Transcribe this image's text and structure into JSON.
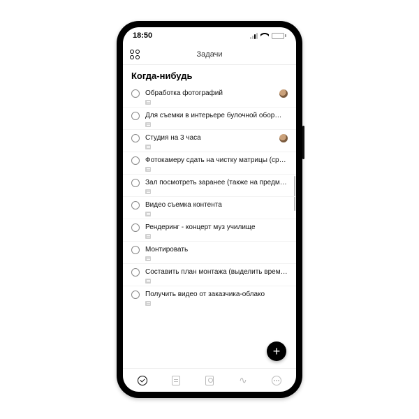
{
  "statusbar": {
    "time": "18:50"
  },
  "header": {
    "title": "Задачи"
  },
  "section": {
    "title": "Когда-нибудь"
  },
  "tasks": [
    {
      "title": "Обработка фотографий",
      "has_note": true,
      "has_avatar": true
    },
    {
      "title": "Для съемки в интерьере булочной обор…",
      "has_note": true,
      "has_avatar": false
    },
    {
      "title": "Студия на 3 часа",
      "has_note": true,
      "has_avatar": true
    },
    {
      "title": "Фотокамеру сдать на чистку матрицы (срочн…",
      "has_note": true,
      "has_avatar": false
    },
    {
      "title": "Зал посмотреть заранее (также на предмет с…",
      "has_note": true,
      "has_avatar": false
    },
    {
      "title": "Видео съемка контента",
      "has_note": true,
      "has_avatar": false
    },
    {
      "title": "Рендеринг - концерт муз училище",
      "has_note": true,
      "has_avatar": false
    },
    {
      "title": "Монтировать",
      "has_note": true,
      "has_avatar": false
    },
    {
      "title": "Составить план монтажа (выделить время в…",
      "has_note": true,
      "has_avatar": false
    },
    {
      "title": "Получить видео от заказчика-облако",
      "has_note": true,
      "has_avatar": false
    }
  ],
  "fab": {
    "label": "+"
  },
  "tabs": {
    "active": 0,
    "items": [
      "tasks",
      "notes",
      "contacts",
      "activity",
      "more"
    ]
  }
}
